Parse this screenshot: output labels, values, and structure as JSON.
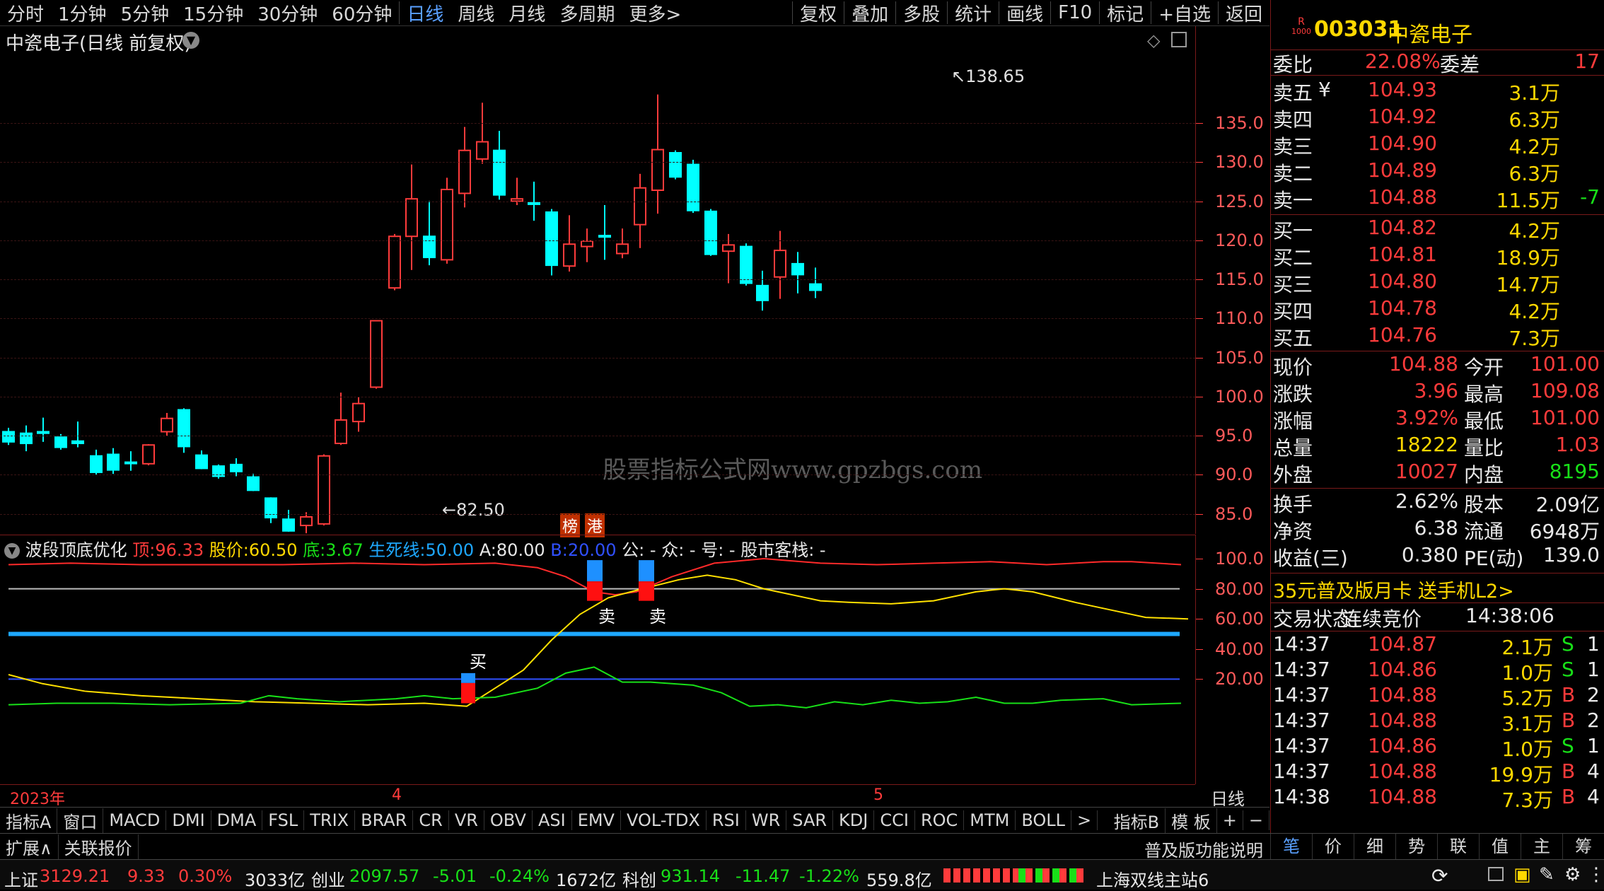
{
  "toolbar": {
    "periods": [
      "分时",
      "1分钟",
      "5分钟",
      "15分钟",
      "30分钟",
      "60分钟",
      "日线",
      "周线",
      "月线",
      "多周期",
      "更多>"
    ],
    "active": "日线",
    "right_buttons": [
      "复权",
      "叠加",
      "多股",
      "统计",
      "画线",
      "F10",
      "标记",
      "+自选",
      "返回"
    ]
  },
  "chart_title": "中瓷电子(日线 前复权)",
  "watermark": "股票指标公式网www.gpzbgs.com",
  "main_chart": {
    "price_axis": [
      "135.0",
      "130.0",
      "125.0",
      "120.0",
      "115.0",
      "110.0",
      "105.0",
      "100.0",
      "95.0",
      "90.0",
      "85.0"
    ],
    "high_label": "138.65",
    "low_label": "82.50",
    "badges": [
      "榜",
      "港"
    ]
  },
  "indicator": {
    "name": "波段顶底优化",
    "top_label": "顶:",
    "top_value": "96.33",
    "price_label": "股价:",
    "price_value": "60.50",
    "bottom_label": "底:",
    "bottom_value": "3.67",
    "life_label": "生死线:",
    "life_value": "50.00",
    "a_label": "A:",
    "a_value": "80.00",
    "b_label": "B:",
    "b_value": "20.00",
    "extra": "公: -  众: -  号: -  股市客栈: -",
    "axis": [
      "100.0",
      "80.00",
      "60.00",
      "40.00",
      "20.00"
    ],
    "buy_label": "买",
    "sell_label": "卖"
  },
  "date_axis": {
    "labels": [
      "2023年",
      "4",
      "5"
    ],
    "period": "日线"
  },
  "indicator_tabs": [
    "指标A",
    "窗口",
    "MACD",
    "DMI",
    "DMA",
    "FSL",
    "TRIX",
    "BRAR",
    "CR",
    "VR",
    "OBV",
    "ASI",
    "EMV",
    "VOL-TDX",
    "RSI",
    "WR",
    "SAR",
    "KDJ",
    "CCI",
    "ROC",
    "MTM",
    "BOLL",
    ">",
    "指标B",
    "模 板",
    "+",
    "−"
  ],
  "ext_row": {
    "left": [
      "扩展∧",
      "关联报价"
    ],
    "right": "普及版功能说明",
    "tabs": [
      "笔",
      "价",
      "细",
      "势",
      "联",
      "值",
      "主",
      "筹"
    ]
  },
  "quote": {
    "code": "003031",
    "name": "中瓷电子",
    "badge_top": "R",
    "badge_bot": "1000",
    "wb_label": "委比",
    "wb_value": "22.08%",
    "wc_label": "委差",
    "wc_value": "17",
    "sells": [
      {
        "label": "卖五",
        "flag": "¥",
        "price": "104.93",
        "vol": "3.1万",
        "chg": ""
      },
      {
        "label": "卖四",
        "flag": "",
        "price": "104.92",
        "vol": "6.3万",
        "chg": ""
      },
      {
        "label": "卖三",
        "flag": "",
        "price": "104.90",
        "vol": "4.2万",
        "chg": ""
      },
      {
        "label": "卖二",
        "flag": "",
        "price": "104.89",
        "vol": "6.3万",
        "chg": ""
      },
      {
        "label": "卖一",
        "flag": "",
        "price": "104.88",
        "vol": "11.5万",
        "chg": "-7"
      }
    ],
    "buys": [
      {
        "label": "买一",
        "price": "104.82",
        "vol": "4.2万"
      },
      {
        "label": "买二",
        "price": "104.81",
        "vol": "18.9万"
      },
      {
        "label": "买三",
        "price": "104.80",
        "vol": "14.7万"
      },
      {
        "label": "买四",
        "price": "104.78",
        "vol": "4.2万"
      },
      {
        "label": "买五",
        "price": "104.76",
        "vol": "7.3万"
      }
    ],
    "stats": [
      {
        "l1": "现价",
        "v1": "104.88",
        "l2": "今开",
        "v2": "101.00",
        "c1": "red",
        "c2": "red"
      },
      {
        "l1": "涨跌",
        "v1": "3.96",
        "l2": "最高",
        "v2": "109.08",
        "c1": "red",
        "c2": "red"
      },
      {
        "l1": "涨幅",
        "v1": "3.92%",
        "l2": "最低",
        "v2": "101.00",
        "c1": "red",
        "c2": "red"
      },
      {
        "l1": "总量",
        "v1": "18222",
        "l2": "量比",
        "v2": "1.03",
        "c1": "yellow",
        "c2": "red"
      },
      {
        "l1": "外盘",
        "v1": "10027",
        "l2": "内盘",
        "v2": "8195",
        "c1": "red",
        "c2": "green"
      }
    ],
    "stats2": [
      {
        "l1": "换手",
        "v1": "2.62%",
        "l2": "股本",
        "v2": "2.09亿"
      },
      {
        "l1": "净资",
        "v1": "6.38",
        "l2": "流通",
        "v2": "6948万"
      },
      {
        "l1": "收益(三)",
        "v1": "0.380",
        "l2": "PE(动)",
        "v2": "139.0"
      }
    ],
    "promo": "35元普及版月卡 送手机L2>",
    "trade_state_label": "交易状态:",
    "trade_state": "连续竞价",
    "trade_time": "14:38:06",
    "ticks": [
      {
        "t": "14:37",
        "p": "104.87",
        "v": "2.1万",
        "s": "S",
        "n": "1"
      },
      {
        "t": "14:37",
        "p": "104.86",
        "v": "1.0万",
        "s": "S",
        "n": "1"
      },
      {
        "t": "14:37",
        "p": "104.88",
        "v": "5.2万",
        "s": "B",
        "n": "2"
      },
      {
        "t": "14:37",
        "p": "104.88",
        "v": "3.1万",
        "s": "B",
        "n": "2"
      },
      {
        "t": "14:37",
        "p": "104.86",
        "v": "1.0万",
        "s": "S",
        "n": "1"
      },
      {
        "t": "14:37",
        "p": "104.88",
        "v": "19.9万",
        "s": "B",
        "n": "4"
      },
      {
        "t": "14:38",
        "p": "104.88",
        "v": "7.3万",
        "s": "B",
        "n": "4"
      }
    ]
  },
  "status_bar": {
    "sh_label": "上证",
    "sh_value": "3129.21",
    "sh_chg": "9.33",
    "sh_pct": "0.30%",
    "sh_amt": "3033亿",
    "cy_label": "创业",
    "cy_value": "2097.57",
    "cy_chg": "-5.01",
    "cy_pct": "-0.24%",
    "cy_amt": "1672亿",
    "kc_label": "科创",
    "kc_value": "931.14",
    "kc_chg": "-11.47",
    "kc_pct": "-1.22%",
    "kc_amt": "559.8亿",
    "server": "上海双线主站6"
  },
  "colors": {
    "up": "#ff3b3b",
    "down": "#00ffff",
    "accent": "#5aa0ff",
    "life_line": "#1ea8ff"
  }
}
